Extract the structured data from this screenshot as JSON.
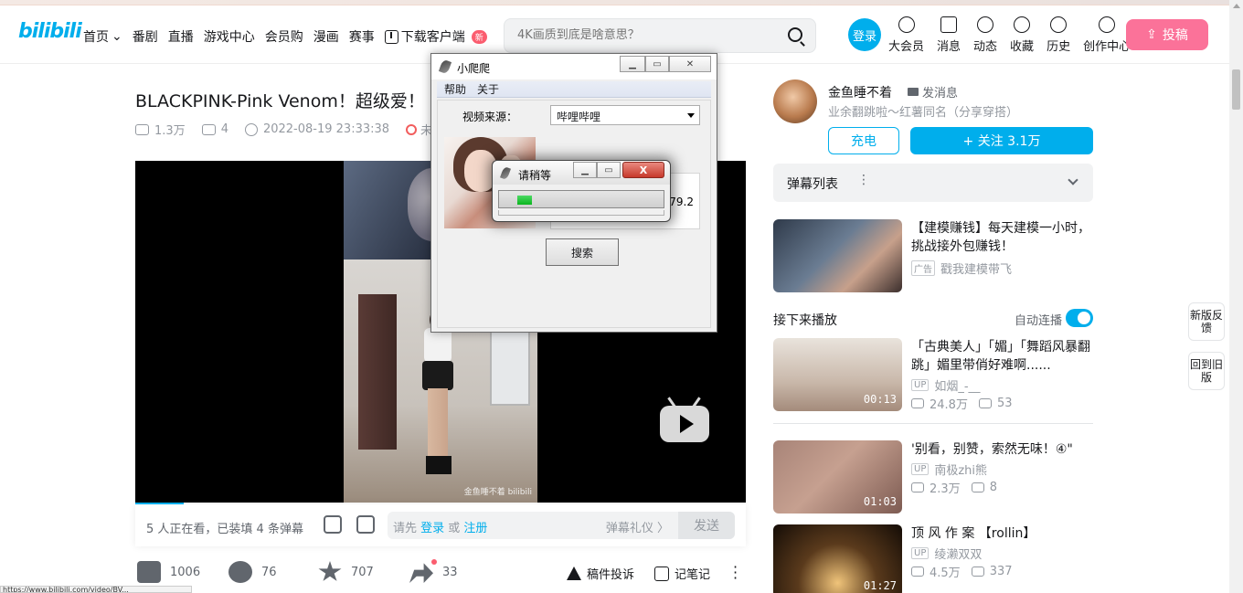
{
  "header": {
    "logo": "bilibili",
    "nav": [
      "首页",
      "番剧",
      "直播",
      "游戏中心",
      "会员购",
      "漫画",
      "赛事",
      "下载客户端"
    ],
    "new_badge": "新",
    "search_placeholder": "4K画质到底是啥意思？",
    "login": "登录",
    "icons": [
      {
        "label": "大会员",
        "icon": "vip-icon"
      },
      {
        "label": "消息",
        "icon": "message-icon"
      },
      {
        "label": "动态",
        "icon": "dynamic-icon"
      },
      {
        "label": "收藏",
        "icon": "favorite-icon"
      },
      {
        "label": "历史",
        "icon": "history-icon"
      },
      {
        "label": "创作中心",
        "icon": "creator-icon"
      }
    ],
    "upload": "投稿"
  },
  "video": {
    "title": "BLACKPINK-Pink Venom！超级爱！",
    "views": "1.3万",
    "danmaku": "4",
    "date": "2022-08-19 23:33:38",
    "notice": "未经作"
  },
  "player": {
    "watermark": "金鱼睡不着 bilibili",
    "progress": 0.08
  },
  "danmaku_bar": {
    "viewers": "5 人正在看，已装填 4 条弹幕",
    "prompt_prefix": "请先 ",
    "login": "登录",
    "or": " 或 ",
    "register": "注册",
    "etiquette": "弹幕礼仪 〉",
    "send": "发送"
  },
  "actions": {
    "like": "1006",
    "coin": "76",
    "favorite": "707",
    "share": "33",
    "report": "稿件投诉",
    "notes": "记笔记"
  },
  "status_url": "https://www.bilibili.com/video/BV...",
  "uploader": {
    "name": "金鱼睡不着",
    "msg": "发消息",
    "desc": "业余翻跳啦～红薯同名（分享穿搭）",
    "charge": "充电",
    "follow": "+ 关注 3.1万"
  },
  "danmaku_list": {
    "label": "弹幕列表"
  },
  "ad": {
    "title": "【建模赚钱】每天建模一小时，挑战接外包赚钱！",
    "tag": "广告",
    "source": "戳我建模带飞"
  },
  "next": {
    "label": "接下来播放",
    "autoplay": "自动连播"
  },
  "recommendations": [
    {
      "title": "「古典美人」「媚」「舞蹈风暴翻跳」媚里带俏好难啊......",
      "up": "如烟_-__",
      "views": "24.8万",
      "danmaku": "53",
      "duration": "00:13"
    },
    {
      "title": "'别看，别赞，索然无味！④\"",
      "up": "南极zhi熊",
      "views": "2.3万",
      "danmaku": "8",
      "duration": "01:03"
    },
    {
      "title": "顶 风 作 案 【rollin】",
      "up": "绫濑双双",
      "views": "4.5万",
      "danmaku": "337",
      "duration": "01:27"
    }
  ],
  "up_tag": "UP",
  "side": {
    "feedback": "新版反馈",
    "old": "回到旧版"
  },
  "app_window": {
    "title": "小爬爬",
    "menu": [
      "帮助",
      "关于"
    ],
    "source_label": "视频来源：",
    "source_value": "哔哩哔哩",
    "result_value": "79.2",
    "search": "搜索"
  },
  "wait_dialog": {
    "title": "请稍等",
    "close": "X",
    "progress": 0.09
  }
}
